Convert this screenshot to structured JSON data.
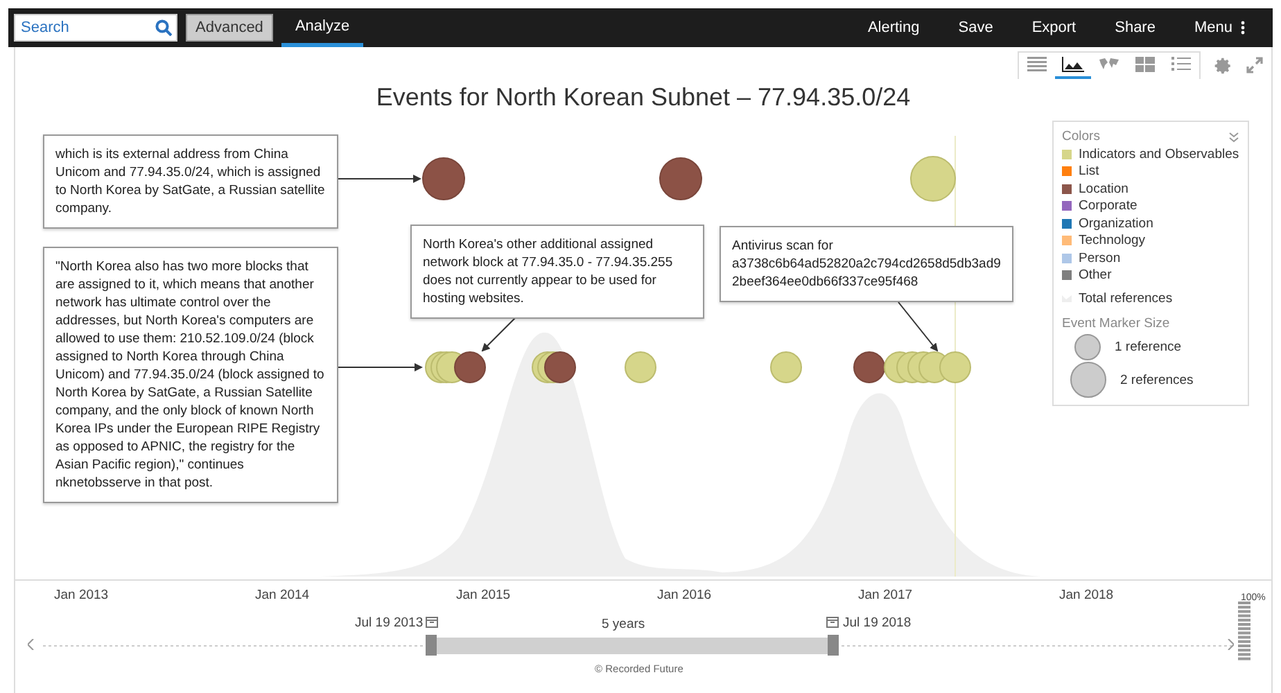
{
  "topbar": {
    "search": {
      "placeholder": "Search"
    },
    "advanced": "Advanced",
    "tabs": [
      {
        "label": "Analyze",
        "selected": true
      }
    ],
    "actions": [
      {
        "label": "Alerting"
      },
      {
        "label": "Save"
      },
      {
        "label": "Export"
      },
      {
        "label": "Share"
      },
      {
        "label": "Menu",
        "kind": "menu"
      }
    ]
  },
  "view_tabs": [
    {
      "kind": "list",
      "selected": false
    },
    {
      "kind": "timeline",
      "selected": true
    },
    {
      "kind": "map",
      "selected": false
    },
    {
      "kind": "grid",
      "selected": false
    },
    {
      "kind": "bullets",
      "selected": false
    }
  ],
  "title": "Events for North Korean Subnet – 77.94.35.0/24",
  "callouts": [
    {
      "text": "which is its external address from China Unicom and 77.94.35.0/24, which is assigned to North Korea by SatGate, a Russian satellite company."
    },
    {
      "text": "\"North Korea also has two more blocks that are assigned to it, which means that another network has ultimate control over the addresses, but North Korea's computers are allowed to use them: 210.52.109.0/24 (block assigned to North Korea through China Unicom) and 77.94.35.0/24 (block assigned to North Korea by SatGate, a Russian Satellite company, and the only block of known North Korea IPs under the European RIPE Registry as opposed to APNIC, the registry for the Asian Pacific region),\" continues nknetobsserve in that post."
    },
    {
      "text": "North Korea's other additional assigned network block at 77.94.35.0 - 77.94.35.255 does not currently appear to be used for hosting websites."
    },
    {
      "text": "Antivirus scan for a3738c6b64ad52820a2c794cd2658d5db3ad92beef364ee0db66f337ce95f468"
    }
  ],
  "legend": {
    "title": "Colors",
    "items": [
      {
        "label": "Indicators and Observables",
        "color": "#d6d68a"
      },
      {
        "label": "List",
        "color": "#ff7f0e"
      },
      {
        "label": "Location",
        "color": "#8c564b"
      },
      {
        "label": "Corporate",
        "color": "#9467bd"
      },
      {
        "label": "Organization",
        "color": "#1f77b4"
      },
      {
        "label": "Technology",
        "color": "#ffbb78"
      },
      {
        "label": "Person",
        "color": "#aec7e8"
      },
      {
        "label": "Other",
        "color": "#7f7f7f"
      }
    ],
    "total": "Total references",
    "size_title": "Event Marker Size",
    "sizes": [
      {
        "label": "1 reference",
        "kind": "small"
      },
      {
        "label": "2 references",
        "kind": "large"
      }
    ]
  },
  "axis_labels": [
    "Jan 2013",
    "Jan 2014",
    "Jan 2015",
    "Jan 2016",
    "Jan 2017",
    "Jan 2018"
  ],
  "range": {
    "start": "Jul 19 2013",
    "end": "Jul 19 2018",
    "duration": "5 years"
  },
  "zoom_label": "100%",
  "footer": "© Recorded Future"
}
